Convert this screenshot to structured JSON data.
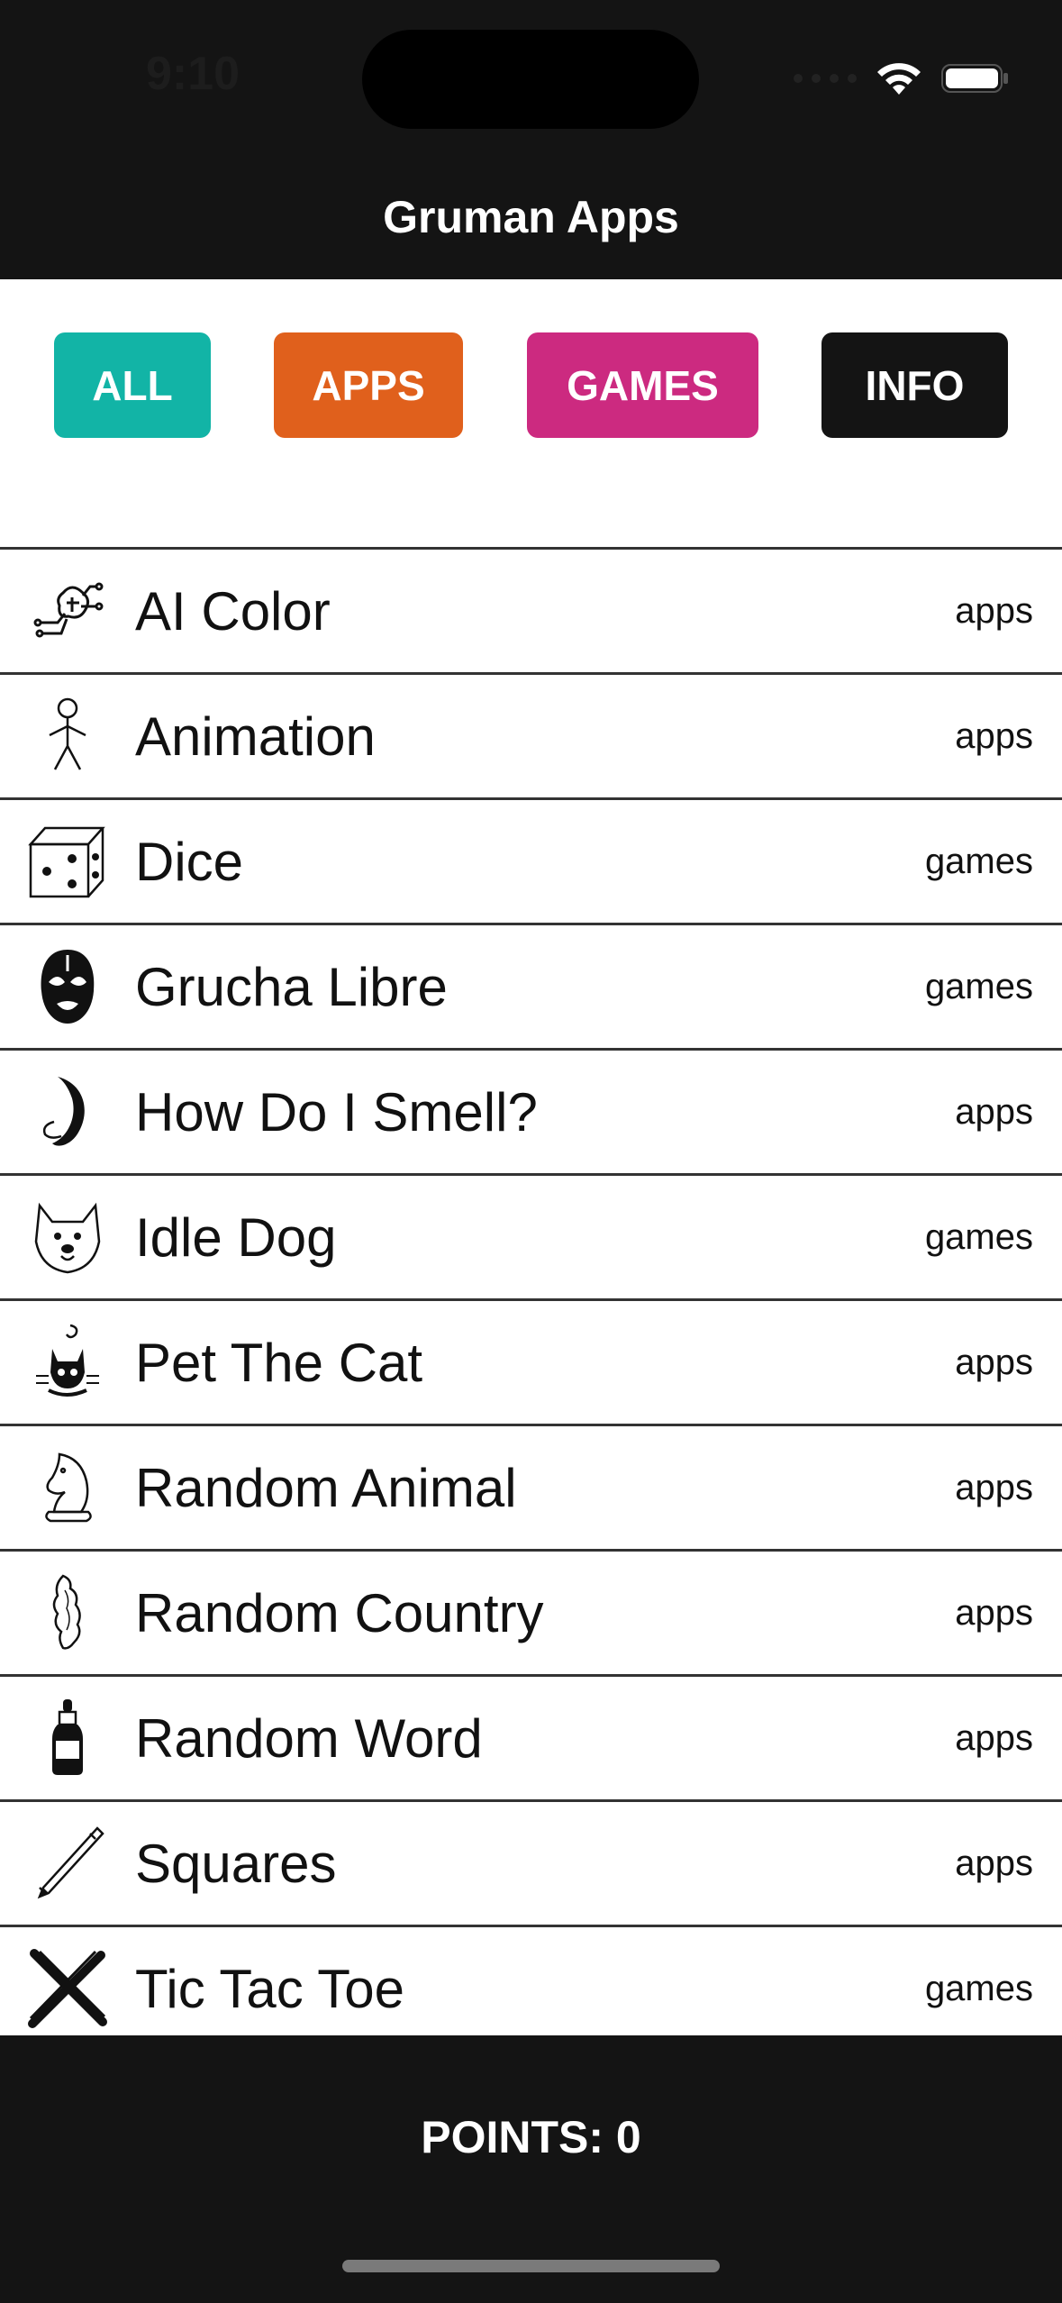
{
  "status": {
    "time": "9:10"
  },
  "header": {
    "title": "Gruman Apps"
  },
  "filters": [
    {
      "label": "ALL",
      "color": "#12b4a6"
    },
    {
      "label": "APPS",
      "color": "#e0601c"
    },
    {
      "label": "GAMES",
      "color": "#cc2a80"
    },
    {
      "label": "INFO",
      "color": "#141414"
    }
  ],
  "list": [
    {
      "name": "AI Color",
      "category": "apps",
      "icon": "brain-circuit-icon"
    },
    {
      "name": "Animation",
      "category": "apps",
      "icon": "stick-figure-icon"
    },
    {
      "name": "Dice",
      "category": "games",
      "icon": "dice-icon"
    },
    {
      "name": "Grucha Libre",
      "category": "games",
      "icon": "wrestler-mask-icon"
    },
    {
      "name": "How Do I Smell?",
      "category": "apps",
      "icon": "nose-icon"
    },
    {
      "name": "Idle Dog",
      "category": "games",
      "icon": "dog-face-icon"
    },
    {
      "name": "Pet The Cat",
      "category": "apps",
      "icon": "cat-icon"
    },
    {
      "name": "Random Animal",
      "category": "apps",
      "icon": "chess-knight-icon"
    },
    {
      "name": "Random Country",
      "category": "apps",
      "icon": "country-map-icon"
    },
    {
      "name": "Random Word",
      "category": "apps",
      "icon": "dropper-bottle-icon"
    },
    {
      "name": "Squares",
      "category": "apps",
      "icon": "pencil-icon"
    },
    {
      "name": "Tic Tac Toe",
      "category": "games",
      "icon": "x-mark-icon"
    }
  ],
  "footer": {
    "points": "POINTS: 0"
  }
}
